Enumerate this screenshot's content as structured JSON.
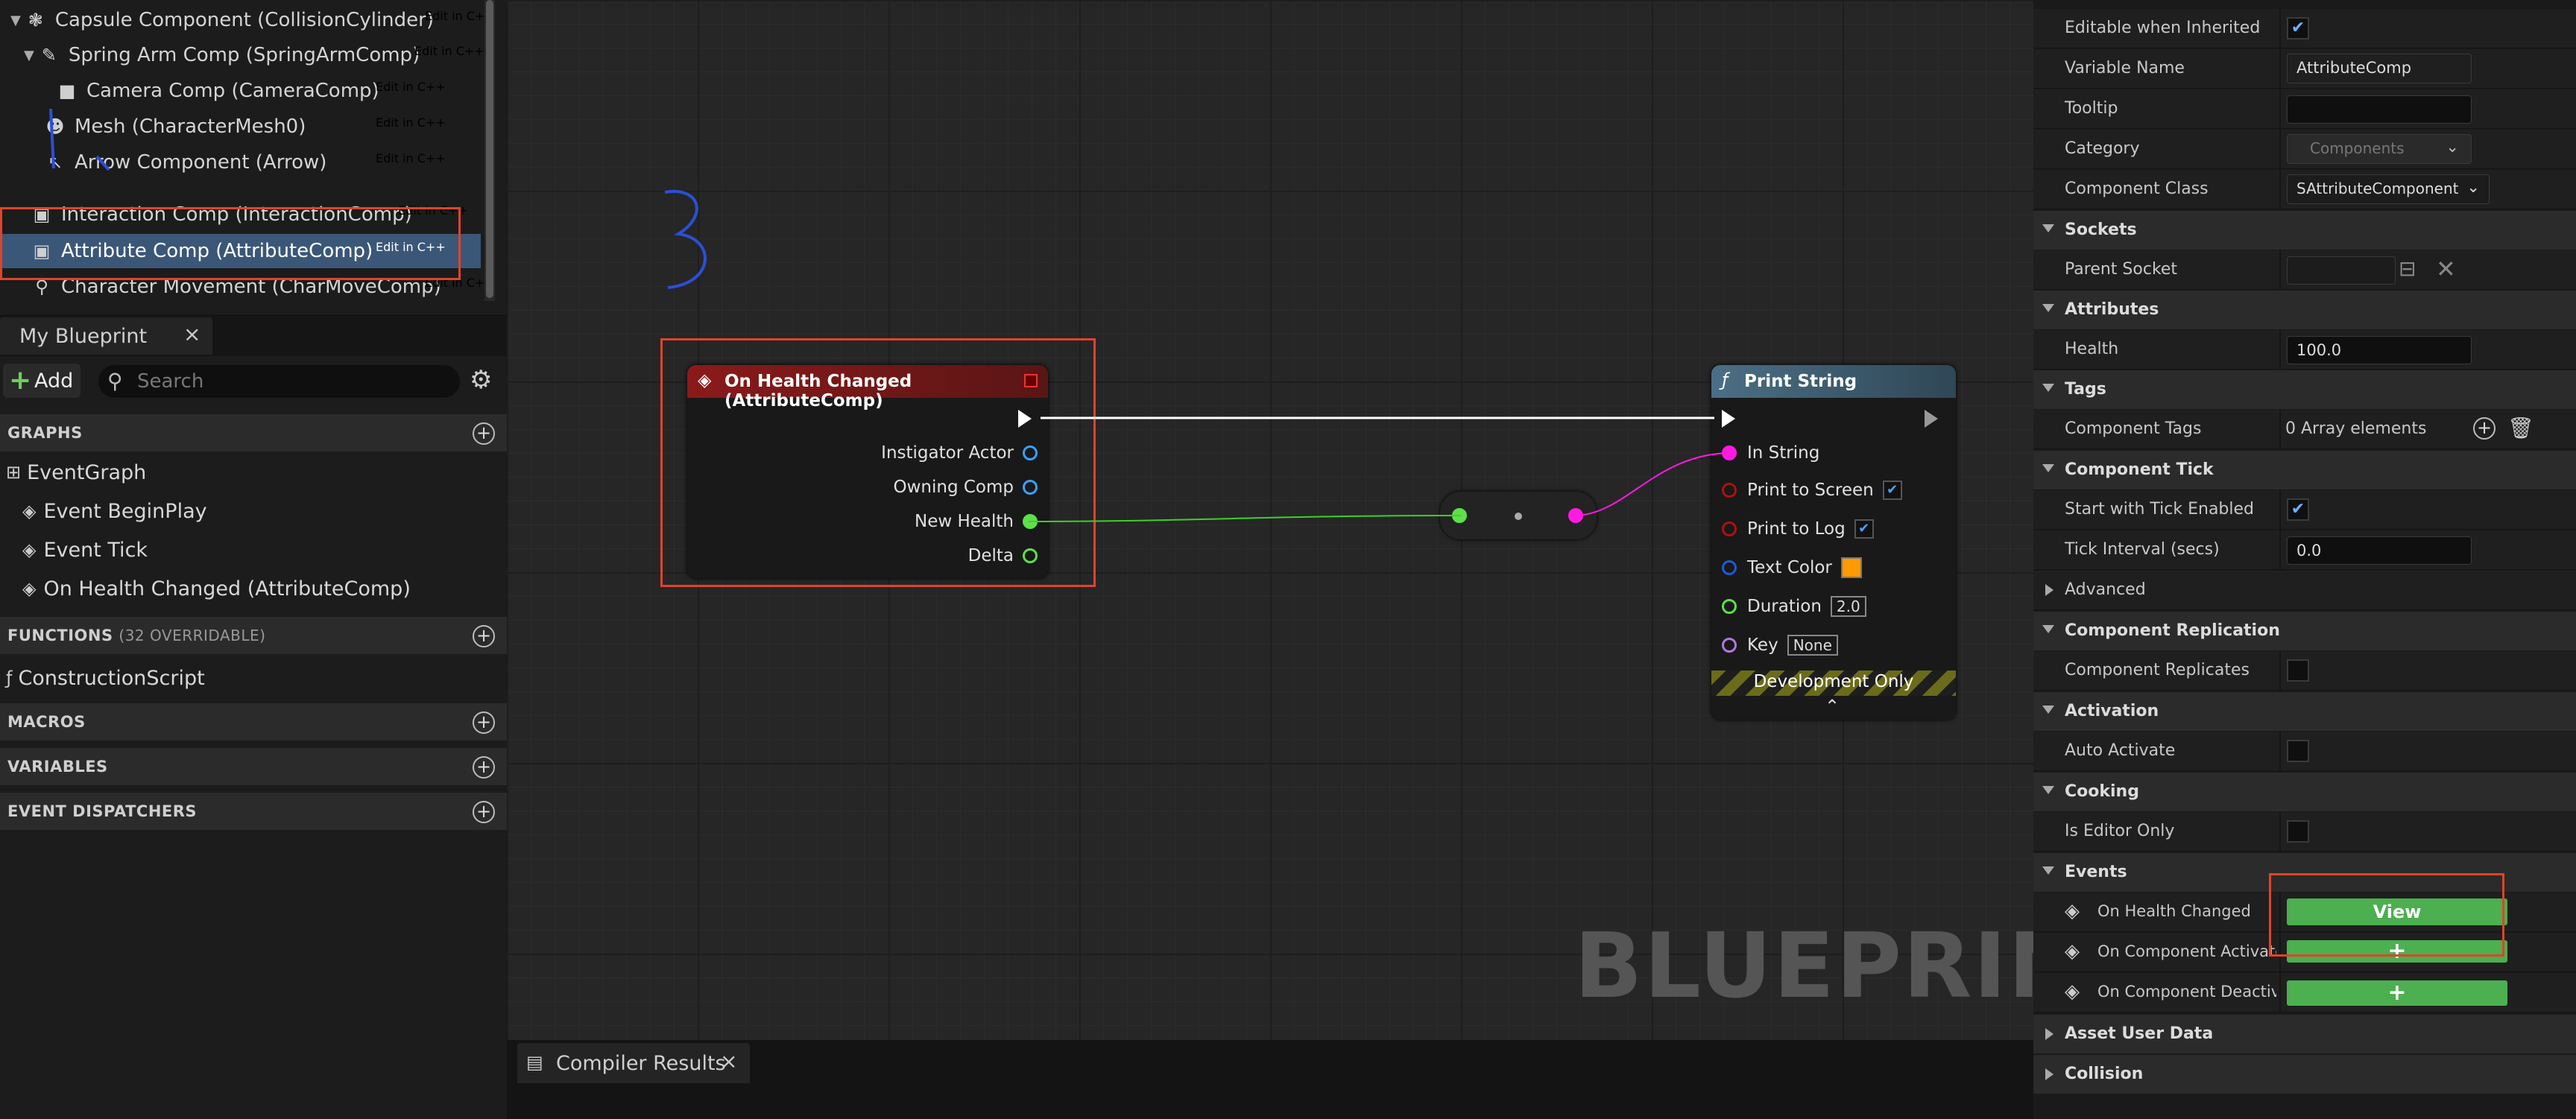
{
  "components": [
    {
      "label": "Capsule Component (CollisionCylinder)",
      "cpp": "Edit in C++",
      "icon": "capsule-icon"
    },
    {
      "label": "Spring Arm Comp (SpringArmComp)",
      "cpp": "Edit in C++",
      "icon": "spring-arm-icon"
    },
    {
      "label": "Camera Comp (CameraComp)",
      "cpp": "Edit in C++",
      "icon": "camera-icon"
    },
    {
      "label": "Mesh (CharacterMesh0)",
      "cpp": "Edit in C++",
      "icon": "mesh-icon"
    },
    {
      "label": "Arrow Component (Arrow)",
      "cpp": "Edit in C++",
      "icon": "arrow-component-icon"
    },
    {
      "label": "Interaction Comp (InteractionComp)",
      "cpp": "Edit in C++",
      "icon": "component-icon"
    },
    {
      "label": "Attribute Comp (AttributeComp)",
      "cpp": "Edit in C++",
      "icon": "component-icon"
    },
    {
      "label": "Character Movement (CharMoveComp)",
      "cpp": "Edit in C++",
      "icon": "movement-icon"
    }
  ],
  "my_blueprint": {
    "tab_label": "My Blueprint",
    "add_label": "Add",
    "search_placeholder": "Search",
    "graphs_header": "GRAPHS",
    "graphs": [
      "EventGraph",
      "Event BeginPlay",
      "Event Tick",
      "On Health Changed (AttributeComp)"
    ],
    "functions_header": "FUNCTIONS",
    "functions_count": "(32 OVERRIDABLE)",
    "functions": [
      "ConstructionScript"
    ],
    "macros_header": "MACROS",
    "variables_header": "VARIABLES",
    "dispatchers_header": "EVENT DISPATCHERS"
  },
  "graph": {
    "event_node": {
      "title": "On Health Changed (AttributeComp)",
      "header_color": "#8b1a1a",
      "pins": [
        "Instigator Actor",
        "Owning Comp",
        "New Health",
        "Delta"
      ]
    },
    "print_node": {
      "title": "Print String",
      "header_color": "#4b6f86",
      "in_string": "In String",
      "print_to_screen": "Print to Screen",
      "print_to_log": "Print to Log",
      "text_color": "Text Color",
      "duration_label": "Duration",
      "duration_value": "2.0",
      "key_label": "Key",
      "key_value": "None",
      "footer": "Development Only"
    },
    "watermark": "BLUEPRINT",
    "annotation": "3"
  },
  "compiler": {
    "tab_label": "Compiler Results"
  },
  "details": {
    "editable_when_inherited": "Editable when Inherited",
    "variable_name_label": "Variable Name",
    "variable_name_value": "AttributeComp",
    "tooltip_label": "Tooltip",
    "category_label": "Category",
    "category_value": "Components",
    "component_class_label": "Component Class",
    "component_class_value": "SAttributeComponent",
    "sockets": "Sockets",
    "parent_socket": "Parent Socket",
    "attributes": "Attributes",
    "health_label": "Health",
    "health_value": "100.0",
    "tags": "Tags",
    "component_tags_label": "Component Tags",
    "component_tags_value": "0 Array elements",
    "component_tick": "Component Tick",
    "start_tick_label": "Start with Tick Enabled",
    "tick_interval_label": "Tick Interval (secs)",
    "tick_interval_value": "0.0",
    "advanced": "Advanced",
    "component_replication": "Component Replication",
    "component_replicates_label": "Component Replicates",
    "activation": "Activation",
    "auto_activate_label": "Auto Activate",
    "cooking": "Cooking",
    "is_editor_only_label": "Is Editor Only",
    "events": "Events",
    "on_health_changed_label": "On Health Changed",
    "view_label": "View",
    "on_component_activated_label": "On Component Activated",
    "on_component_deactivated_label": "On Component Deactivated",
    "asset_user_data": "Asset User Data",
    "collision": "Collision"
  },
  "colors": {
    "accent_green": "#4caf50",
    "highlight_red": "#e0432b",
    "annotation_blue": "#2b4fd8",
    "selected_row": "#3b5778"
  }
}
